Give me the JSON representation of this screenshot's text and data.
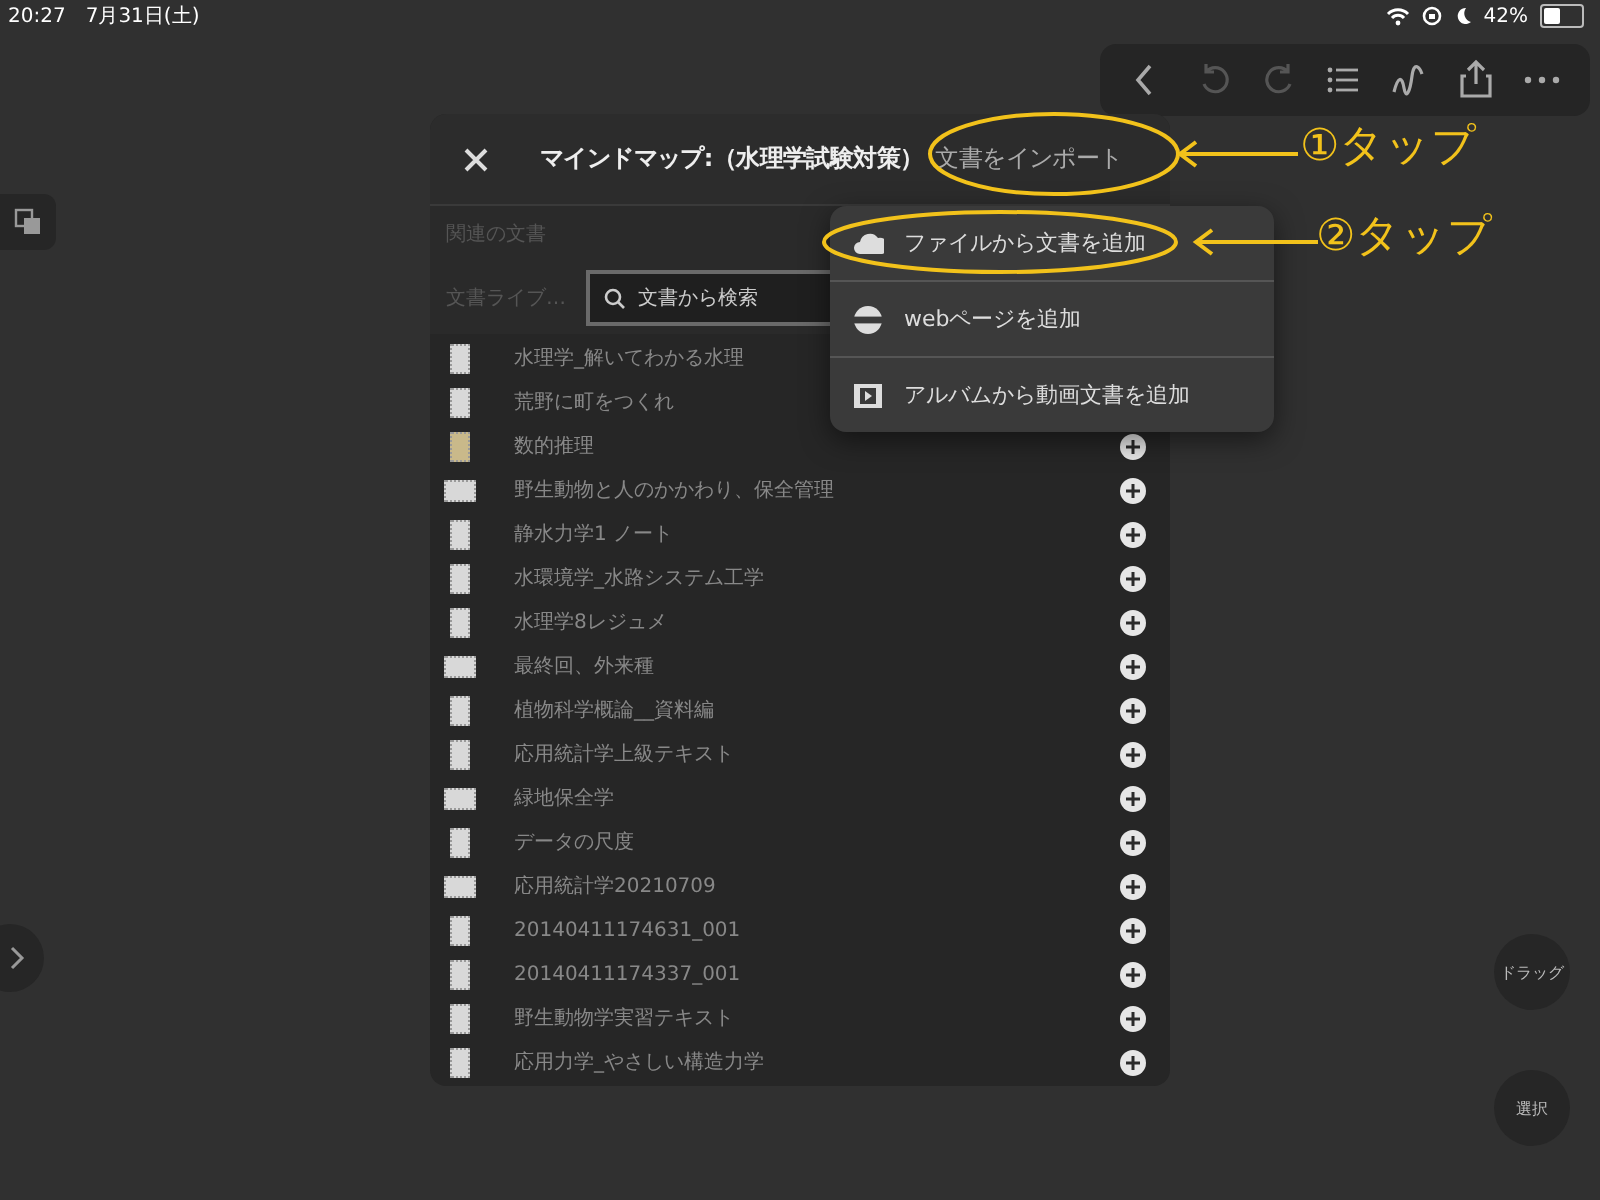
{
  "status_bar": {
    "time": "20:27",
    "date": "7月31日(土)",
    "battery": "42%"
  },
  "side_buttons": [
    {
      "label": "ドラッグ"
    },
    {
      "label": "選択"
    }
  ],
  "dialog": {
    "title": "マインドマップ:（水理学試験対策）",
    "action": "文書をインポート",
    "related_label": "関連の文書",
    "library_label": "文書ライブ…",
    "search": {
      "placeholder": "文書から検索"
    },
    "documents": [
      {
        "name": "水理学_解いてわかる水理",
        "kind": "portrait",
        "add_button": false
      },
      {
        "name": "荒野に町をつくれ",
        "kind": "portrait",
        "add_button": false
      },
      {
        "name": "数的推理",
        "kind": "color",
        "add_button": true
      },
      {
        "name": "野生動物と人のかかわり、保全管理",
        "kind": "landscape",
        "add_button": true
      },
      {
        "name": "静水力学1 ノート",
        "kind": "portrait",
        "add_button": true
      },
      {
        "name": "水環境学_水路システム工学",
        "kind": "portrait",
        "add_button": true
      },
      {
        "name": "水理学8レジュメ",
        "kind": "portrait",
        "add_button": true
      },
      {
        "name": "最終回、外来種",
        "kind": "landscape",
        "add_button": true
      },
      {
        "name": "植物科学概論__資料編",
        "kind": "portrait",
        "add_button": true
      },
      {
        "name": "応用統計学上級テキスト",
        "kind": "portrait",
        "add_button": true
      },
      {
        "name": "緑地保全学",
        "kind": "landscape",
        "add_button": true
      },
      {
        "name": "データの尺度",
        "kind": "portrait",
        "add_button": true
      },
      {
        "name": "応用統計学20210709",
        "kind": "landscape",
        "add_button": true
      },
      {
        "name": "20140411174631_001",
        "kind": "portrait",
        "add_button": true
      },
      {
        "name": "20140411174337_001",
        "kind": "portrait",
        "add_button": true
      },
      {
        "name": "野生動物学実習テキスト",
        "kind": "portrait",
        "add_button": true
      },
      {
        "name": "応用力学_やさしい構造力学",
        "kind": "portrait",
        "add_button": true
      }
    ]
  },
  "import_menu": [
    {
      "label": "ファイルから文書を追加",
      "kind": "cloud"
    },
    {
      "label": "webページを追加",
      "kind": "globe"
    },
    {
      "label": "アルバムから動画文書を追加",
      "kind": "film"
    }
  ],
  "annotations": [
    {
      "label": "①タップ"
    },
    {
      "label": "②タップ"
    }
  ]
}
